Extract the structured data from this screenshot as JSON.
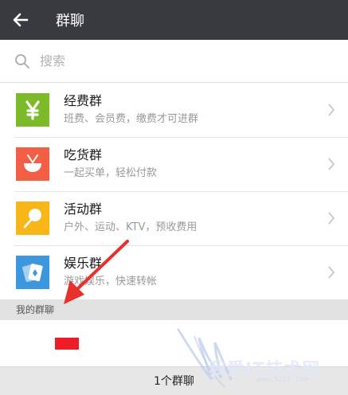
{
  "header": {
    "title": "群聊",
    "back_icon": "arrow-left-icon"
  },
  "search": {
    "placeholder": "搜索",
    "icon": "search-icon"
  },
  "groups": [
    {
      "title": "经费群",
      "subtitle": "班费、会员费，缴费才可进群",
      "icon": "yen-icon",
      "color": "#7dba2a"
    },
    {
      "title": "吃货群",
      "subtitle": "一起买单，轻松付款",
      "icon": "bowl-icon",
      "color": "#f25f45"
    },
    {
      "title": "活动群",
      "subtitle": "户外、运动、KTV，预收费用",
      "icon": "balloon-icon",
      "color": "#f8b619"
    },
    {
      "title": "娱乐群",
      "subtitle": "游戏娱乐，快速转帐",
      "icon": "cards-icon",
      "color": "#3d97dd"
    }
  ],
  "section": {
    "label": "我的群聊"
  },
  "footer": {
    "label": "1个群聊"
  },
  "watermark": {
    "text": "我爱IT技术网",
    "url": "www.52ij.com"
  },
  "colors": {
    "titlebar": "#393a3f",
    "annotation_arrow": "#e8312d",
    "redaction": "#ee1c24"
  }
}
